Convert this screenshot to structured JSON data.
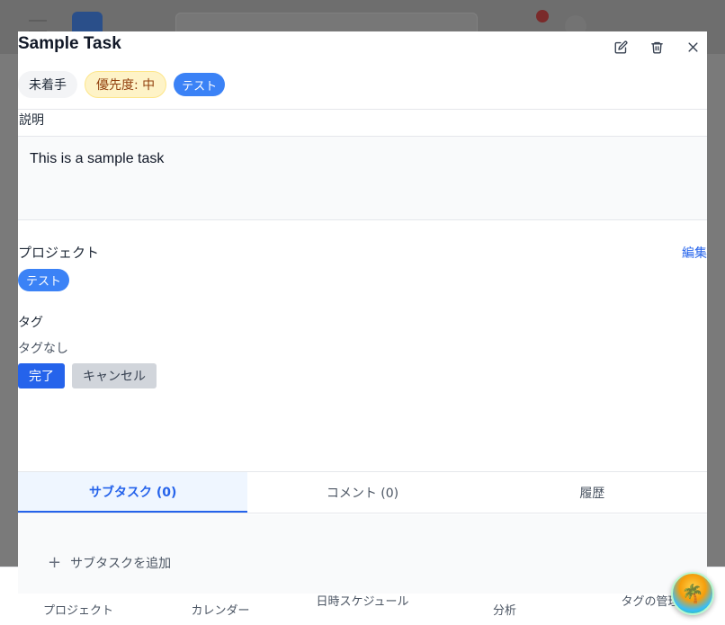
{
  "modal": {
    "title": "Sample Task",
    "status": "未着手",
    "priority": "優先度: 中",
    "tag_badge": "テスト",
    "description_label": "説明",
    "description": "This is a sample task",
    "project_label": "プロジェクト",
    "edit_label": "編集",
    "project_tag": "テスト",
    "tags_label": "タグ",
    "no_tags": "タグなし",
    "done_button": "完了",
    "cancel_button": "キャンセル",
    "tabs": [
      {
        "label": "サブタスク (0)",
        "active": true
      },
      {
        "label": "コメント (0)",
        "active": false
      },
      {
        "label": "履歴",
        "active": false
      }
    ],
    "add_subtask": "サブタスクを追加"
  },
  "bottom_nav": {
    "items": [
      {
        "label": "プロジェクト",
        "icon": "folder-icon"
      },
      {
        "label": "カレンダー",
        "icon": "calendar-icon"
      },
      {
        "label": "日時スケジュール",
        "icon": "clock-icon"
      },
      {
        "label": "分析",
        "icon": "chart-icon"
      },
      {
        "label": "タグの管理",
        "icon": "tag-icon"
      }
    ]
  },
  "colors": {
    "accent": "#2563eb",
    "tag_blue": "#3b82f6",
    "priority_bg": "#fef3c7",
    "priority_text": "#92400e"
  }
}
